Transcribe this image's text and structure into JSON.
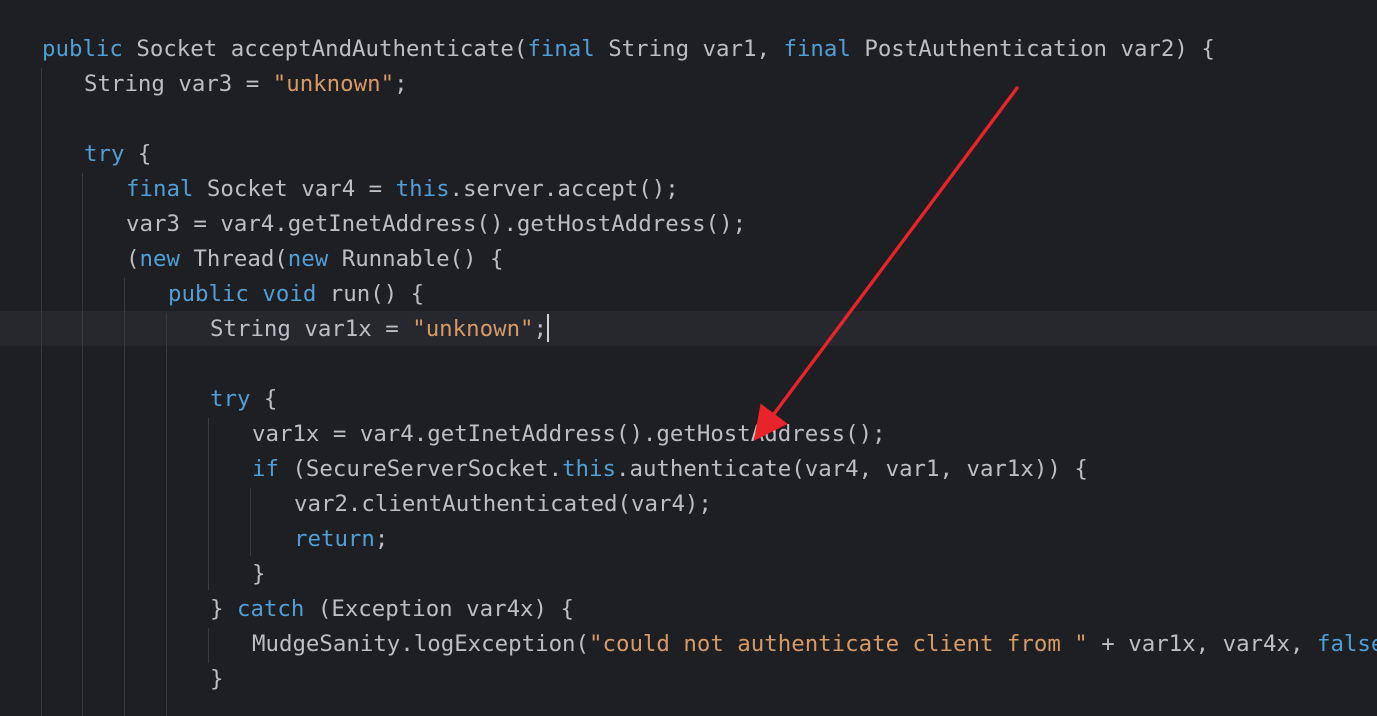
{
  "editor": {
    "language": "Java",
    "theme_colors": {
      "background": "#1e1f22",
      "current_line": "#26282e",
      "text": "#bcbec4",
      "keyword": "#4f9fd6",
      "string": "#d69a66",
      "annotation_arrow": "#e8232a"
    },
    "lines": [
      [
        {
          "t": "public",
          "k": "kw"
        },
        {
          "t": " Socket acceptAndAuthenticate(",
          "k": "plain"
        },
        {
          "t": "final",
          "k": "kw"
        },
        {
          "t": " String var1, ",
          "k": "plain"
        },
        {
          "t": "final",
          "k": "kw"
        },
        {
          "t": " PostAuthentication var2) {",
          "k": "plain"
        }
      ],
      [
        {
          "t": "String var3 = ",
          "k": "plain"
        },
        {
          "t": "\"unknown\"",
          "k": "str"
        },
        {
          "t": ";",
          "k": "plain"
        }
      ],
      [],
      [
        {
          "t": "try",
          "k": "kw"
        },
        {
          "t": " {",
          "k": "plain"
        }
      ],
      [
        {
          "t": "final",
          "k": "kw"
        },
        {
          "t": " Socket var4 = ",
          "k": "plain"
        },
        {
          "t": "this",
          "k": "kw"
        },
        {
          "t": ".server.accept();",
          "k": "plain"
        }
      ],
      [
        {
          "t": "var3 = var4.getInetAddress().getHostAddress();",
          "k": "plain"
        }
      ],
      [
        {
          "t": "(",
          "k": "plain"
        },
        {
          "t": "new",
          "k": "kw"
        },
        {
          "t": " Thread(",
          "k": "plain"
        },
        {
          "t": "new",
          "k": "kw"
        },
        {
          "t": " Runnable() {",
          "k": "plain"
        }
      ],
      [
        {
          "t": "public",
          "k": "kw"
        },
        {
          "t": " ",
          "k": "plain"
        },
        {
          "t": "void",
          "k": "kw"
        },
        {
          "t": " run() {",
          "k": "plain"
        }
      ],
      [
        {
          "t": "String var1x = ",
          "k": "plain"
        },
        {
          "t": "\"unknown\"",
          "k": "str"
        },
        {
          "t": ";",
          "k": "plain"
        }
      ],
      [],
      [
        {
          "t": "try",
          "k": "kw"
        },
        {
          "t": " {",
          "k": "plain"
        }
      ],
      [
        {
          "t": "var1x = var4.getInetAddress().getHostAddress();",
          "k": "plain"
        }
      ],
      [
        {
          "t": "if",
          "k": "kw"
        },
        {
          "t": " (SecureServerSocket.",
          "k": "plain"
        },
        {
          "t": "this",
          "k": "kw"
        },
        {
          "t": ".authenticate(var4, var1, var1x)) {",
          "k": "plain"
        }
      ],
      [
        {
          "t": "var2.clientAuthenticated(var4);",
          "k": "plain"
        }
      ],
      [
        {
          "t": "return",
          "k": "kw"
        },
        {
          "t": ";",
          "k": "plain"
        }
      ],
      [
        {
          "t": "}",
          "k": "plain"
        }
      ],
      [
        {
          "t": "} ",
          "k": "plain"
        },
        {
          "t": "catch",
          "k": "kw"
        },
        {
          "t": " (Exception var4x) {",
          "k": "plain"
        }
      ],
      [
        {
          "t": "MudgeSanity.logException(",
          "k": "plain"
        },
        {
          "t": "\"could not authenticate client from \"",
          "k": "str"
        },
        {
          "t": " + var1x, var4x, ",
          "k": "plain"
        },
        {
          "t": "false",
          "k": "kw"
        },
        {
          "t": ");",
          "k": "plain"
        }
      ],
      [
        {
          "t": "}",
          "k": "plain"
        }
      ]
    ],
    "cursor": {
      "line": 9,
      "after_text": true
    }
  }
}
